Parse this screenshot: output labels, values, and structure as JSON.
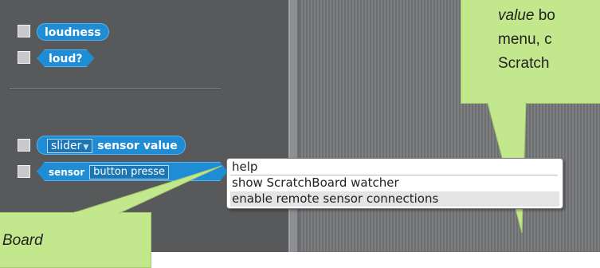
{
  "palette": {
    "blocks": {
      "loudness": "loudness",
      "loud": "loud?",
      "slider_dropdown": "slider",
      "sensor_value": "sensor value",
      "sensor": "sensor",
      "button_pressed": "button presse"
    }
  },
  "context_menu": {
    "items": [
      "help",
      "show ScratchBoard watcher",
      "enable remote sensor connections"
    ],
    "highlighted_index": 2
  },
  "callouts": {
    "top_right": {
      "italic_word": "value",
      "line1_rest": " bo",
      "line2": "menu, c",
      "line3": "Scratch"
    },
    "bottom_left": {
      "text": "Board"
    }
  },
  "colors": {
    "block_blue": "#1f8dd6",
    "palette_bg": "#58595b",
    "callout_green": "#c2e78c"
  }
}
